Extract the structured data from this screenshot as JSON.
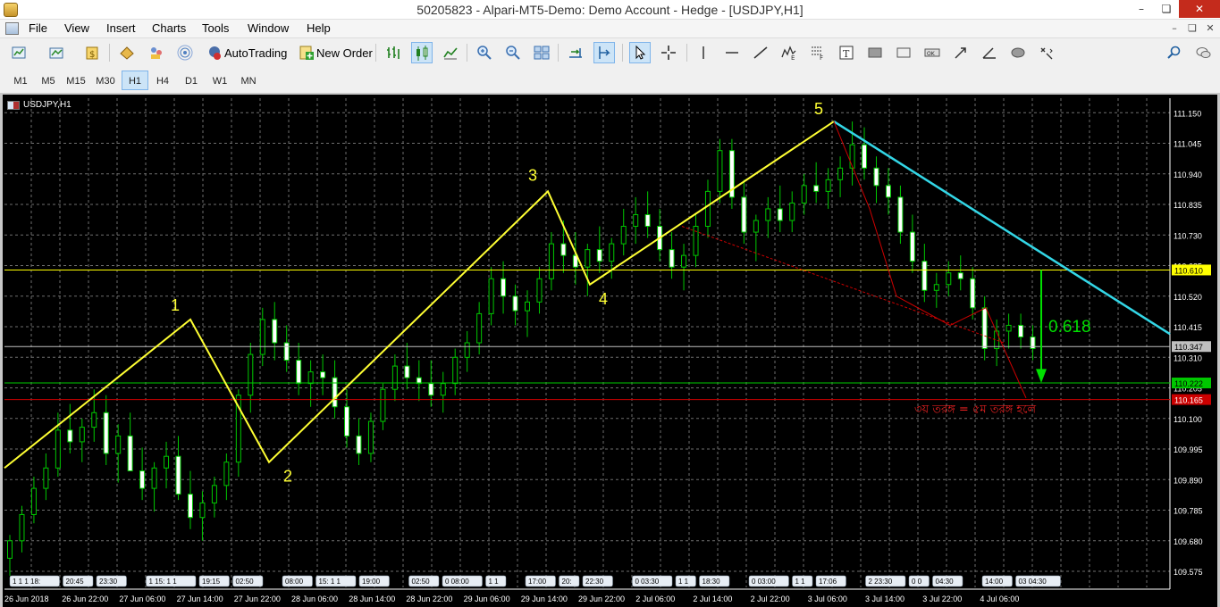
{
  "window": {
    "title": "50205823 - Alpari-MT5-Demo: Demo Account - Hedge - [USDJPY,H1]",
    "minimize": "–",
    "maximize": "❏",
    "close": "✕"
  },
  "menu": {
    "items": [
      "File",
      "View",
      "Insert",
      "Charts",
      "Tools",
      "Window",
      "Help"
    ],
    "mdi": [
      "–",
      "❏",
      "✕"
    ]
  },
  "toolbar": {
    "autotrading_label": "AutoTrading",
    "new_order_label": "New Order"
  },
  "timeframes": {
    "items": [
      "M1",
      "M5",
      "M15",
      "M30",
      "H1",
      "H4",
      "D1",
      "W1",
      "MN"
    ],
    "selected": "H1"
  },
  "chart": {
    "symbol_label": "USDJPY,H1",
    "colors": {
      "background": "#000000",
      "grid": "#6e6e6e",
      "bull": "#00c800",
      "bear_fill": "#ffffff",
      "wave": "#ffff33",
      "trendline": "#33d6e6",
      "fib": "#00e000",
      "red_line": "#cc0000",
      "ask_line": "#e0e070"
    },
    "y_ticks": [
      "111.150",
      "111.045",
      "110.940",
      "110.835",
      "110.730",
      "110.625",
      "110.520",
      "110.415",
      "110.310",
      "110.205",
      "110.100",
      "109.995",
      "109.890",
      "109.785",
      "109.680",
      "109.575"
    ],
    "x_ticks": [
      "26 Jun 2018",
      "26 Jun 22:00",
      "27 Jun 06:00",
      "27 Jun 14:00",
      "27 Jun 22:00",
      "28 Jun 06:00",
      "28 Jun 14:00",
      "28 Jun 22:00",
      "29 Jun 06:00",
      "29 Jun 14:00",
      "29 Jun 22:00",
      "2 Jul 06:00",
      "2 Jul 14:00",
      "2 Jul 22:00",
      "3 Jul 06:00",
      "3 Jul 14:00",
      "3 Jul 22:00",
      "4 Jul 06:00"
    ],
    "price_tags": [
      {
        "label": "110.610",
        "price": 110.61,
        "color": "#ffff00",
        "text": "#000000"
      },
      {
        "label": "110.347",
        "price": 110.347,
        "color": "#c0c0c0",
        "text": "#000000"
      },
      {
        "label": "110.222",
        "price": 110.222,
        "color": "#00c800",
        "text": "#000000"
      },
      {
        "label": "110.165",
        "price": 110.165,
        "color": "#cc0000",
        "text": "#ffffff"
      }
    ],
    "wave_labels": [
      "1",
      "2",
      "3",
      "4",
      "5"
    ],
    "fib_label": "0.618",
    "annotation": "৩য় তরঙ্গ = ৫ম তরঙ্গ হলে",
    "event_labels": [
      "1 1 1 18:",
      "20:45",
      "23:30",
      "1 15: 1 1",
      "19:15",
      "02:50",
      "08:00",
      "15: 1 1",
      "19:00",
      "02:50",
      "0 08:00",
      "1 1",
      "17:00",
      "20:",
      "22:30",
      "0 03:30",
      "1 1",
      "18:30",
      "0 03:00",
      "1 1",
      "17:06",
      "2 23:30",
      "0 0",
      "04:30",
      "14:00",
      "03 04:30"
    ]
  },
  "chart_data": {
    "type": "candlestick",
    "symbol": "USDJPY",
    "timeframe": "H1",
    "ylim": [
      109.52,
      111.2
    ],
    "waves": [
      {
        "label": "",
        "price": 109.93
      },
      {
        "label": "1",
        "price": 110.44
      },
      {
        "label": "2",
        "price": 109.95
      },
      {
        "label": "3",
        "price": 110.88
      },
      {
        "label": "4",
        "price": 110.56
      },
      {
        "label": "5",
        "price": 111.12
      }
    ],
    "candles": [
      [
        109.62,
        109.7,
        109.56,
        109.68
      ],
      [
        109.68,
        109.8,
        109.64,
        109.77
      ],
      [
        109.77,
        109.9,
        109.74,
        109.86
      ],
      [
        109.86,
        109.98,
        109.82,
        109.93
      ],
      [
        109.93,
        110.12,
        109.9,
        110.06
      ],
      [
        110.06,
        110.15,
        109.98,
        110.02
      ],
      [
        110.02,
        110.1,
        109.95,
        110.07
      ],
      [
        110.07,
        110.2,
        110.02,
        110.12
      ],
      [
        110.12,
        110.18,
        109.94,
        109.98
      ],
      [
        109.98,
        110.08,
        109.88,
        110.04
      ],
      [
        110.04,
        110.12,
        109.98,
        109.92
      ],
      [
        109.92,
        110.0,
        109.82,
        109.86
      ],
      [
        109.86,
        109.95,
        109.78,
        109.93
      ],
      [
        109.93,
        110.02,
        109.86,
        109.97
      ],
      [
        109.97,
        110.04,
        109.82,
        109.84
      ],
      [
        109.84,
        109.92,
        109.72,
        109.76
      ],
      [
        109.76,
        109.85,
        109.68,
        109.81
      ],
      [
        109.81,
        109.9,
        109.76,
        109.87
      ],
      [
        109.87,
        109.98,
        109.82,
        109.95
      ],
      [
        109.95,
        110.2,
        109.9,
        110.18
      ],
      [
        110.18,
        110.36,
        110.12,
        110.32
      ],
      [
        110.32,
        110.48,
        110.28,
        110.44
      ],
      [
        110.44,
        110.5,
        110.3,
        110.36
      ],
      [
        110.36,
        110.42,
        110.26,
        110.3
      ],
      [
        110.3,
        110.36,
        110.18,
        110.22
      ],
      [
        110.22,
        110.3,
        110.14,
        110.26
      ],
      [
        110.26,
        110.32,
        110.18,
        110.24
      ],
      [
        110.24,
        110.3,
        110.1,
        110.14
      ],
      [
        110.14,
        110.2,
        110.0,
        110.04
      ],
      [
        110.04,
        110.1,
        109.94,
        109.98
      ],
      [
        109.98,
        110.12,
        109.95,
        110.09
      ],
      [
        110.09,
        110.22,
        110.06,
        110.2
      ],
      [
        110.2,
        110.32,
        110.16,
        110.28
      ],
      [
        110.28,
        110.36,
        110.2,
        110.24
      ],
      [
        110.24,
        110.3,
        110.16,
        110.22
      ],
      [
        110.22,
        110.3,
        110.14,
        110.18
      ],
      [
        110.18,
        110.26,
        110.12,
        110.22
      ],
      [
        110.22,
        110.34,
        110.18,
        110.31
      ],
      [
        110.31,
        110.4,
        110.26,
        110.36
      ],
      [
        110.36,
        110.5,
        110.32,
        110.46
      ],
      [
        110.46,
        110.62,
        110.42,
        110.58
      ],
      [
        110.58,
        110.64,
        110.46,
        110.52
      ],
      [
        110.52,
        110.56,
        110.42,
        110.47
      ],
      [
        110.47,
        110.54,
        110.38,
        110.5
      ],
      [
        110.5,
        110.62,
        110.46,
        110.58
      ],
      [
        110.58,
        110.74,
        110.54,
        110.7
      ],
      [
        110.7,
        110.78,
        110.6,
        110.66
      ],
      [
        110.66,
        110.74,
        110.56,
        110.62
      ],
      [
        110.62,
        110.7,
        110.52,
        110.68
      ],
      [
        110.68,
        110.76,
        110.6,
        110.64
      ],
      [
        110.64,
        110.72,
        110.58,
        110.7
      ],
      [
        110.7,
        110.82,
        110.66,
        110.76
      ],
      [
        110.76,
        110.86,
        110.7,
        110.8
      ],
      [
        110.8,
        110.88,
        110.72,
        110.76
      ],
      [
        110.76,
        110.82,
        110.64,
        110.68
      ],
      [
        110.68,
        110.74,
        110.58,
        110.62
      ],
      [
        110.62,
        110.7,
        110.54,
        110.66
      ],
      [
        110.66,
        110.8,
        110.62,
        110.76
      ],
      [
        110.76,
        110.92,
        110.72,
        110.88
      ],
      [
        110.88,
        111.06,
        110.84,
        111.02
      ],
      [
        111.02,
        111.06,
        110.82,
        110.86
      ],
      [
        110.86,
        110.92,
        110.7,
        110.74
      ],
      [
        110.74,
        110.8,
        110.64,
        110.78
      ],
      [
        110.78,
        110.86,
        110.72,
        110.82
      ],
      [
        110.82,
        110.9,
        110.74,
        110.78
      ],
      [
        110.78,
        110.88,
        110.74,
        110.84
      ],
      [
        110.84,
        110.94,
        110.8,
        110.9
      ],
      [
        110.9,
        110.98,
        110.84,
        110.88
      ],
      [
        110.88,
        110.96,
        110.82,
        110.92
      ],
      [
        110.92,
        111.0,
        110.86,
        110.96
      ],
      [
        110.96,
        111.12,
        110.9,
        111.04
      ],
      [
        111.04,
        111.1,
        110.92,
        110.96
      ],
      [
        110.96,
        111.0,
        110.84,
        110.9
      ],
      [
        110.9,
        110.96,
        110.8,
        110.86
      ],
      [
        110.86,
        110.9,
        110.7,
        110.74
      ],
      [
        110.74,
        110.8,
        110.6,
        110.64
      ],
      [
        110.64,
        110.7,
        110.5,
        110.54
      ],
      [
        110.54,
        110.6,
        110.48,
        110.56
      ],
      [
        110.56,
        110.64,
        110.52,
        110.6
      ],
      [
        110.6,
        110.66,
        110.54,
        110.58
      ],
      [
        110.58,
        110.62,
        110.44,
        110.48
      ],
      [
        110.48,
        110.52,
        110.3,
        110.34
      ],
      [
        110.34,
        110.44,
        110.28,
        110.4
      ],
      [
        110.4,
        110.46,
        110.34,
        110.42
      ],
      [
        110.42,
        110.46,
        110.34,
        110.38
      ],
      [
        110.38,
        110.42,
        110.3,
        110.34
      ]
    ]
  }
}
